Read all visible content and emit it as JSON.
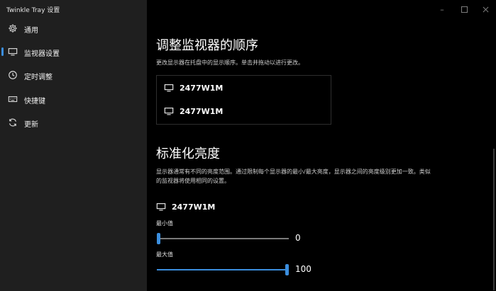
{
  "app": {
    "title": "Twinkle Tray 设置"
  },
  "sidebar": {
    "items": [
      {
        "label": "通用",
        "icon": "gear-icon",
        "active": false
      },
      {
        "label": "监视器设置",
        "icon": "monitor-icon",
        "active": true
      },
      {
        "label": "定时调整",
        "icon": "clock-icon",
        "active": false
      },
      {
        "label": "快捷键",
        "icon": "keyboard-icon",
        "active": false
      },
      {
        "label": "更新",
        "icon": "refresh-icon",
        "active": false
      }
    ]
  },
  "reorder": {
    "title": "调整监视器的顺序",
    "description": "更改显示器在托盘中的显示顺序。单击并拖动以进行更改。",
    "monitors": [
      "2477W1M",
      "2477W1M"
    ]
  },
  "normalize": {
    "title": "标准化亮度",
    "description_line1": "显示器通常有不同的亮度范围。通过限制每个显示器的最小/最大亮度，显示器之间的亮度级别更加一致。类似",
    "description_line2": "的监视器将使用相同的设置。",
    "monitor_name": "2477W1M",
    "min": {
      "label": "最小值",
      "value": "0",
      "fraction": 0
    },
    "max": {
      "label": "最大值",
      "value": "100",
      "fraction": 1
    }
  },
  "colors": {
    "accent": "#3b8ede",
    "sidebar_bg": "#1f1f1f",
    "main_bg": "#000000"
  }
}
